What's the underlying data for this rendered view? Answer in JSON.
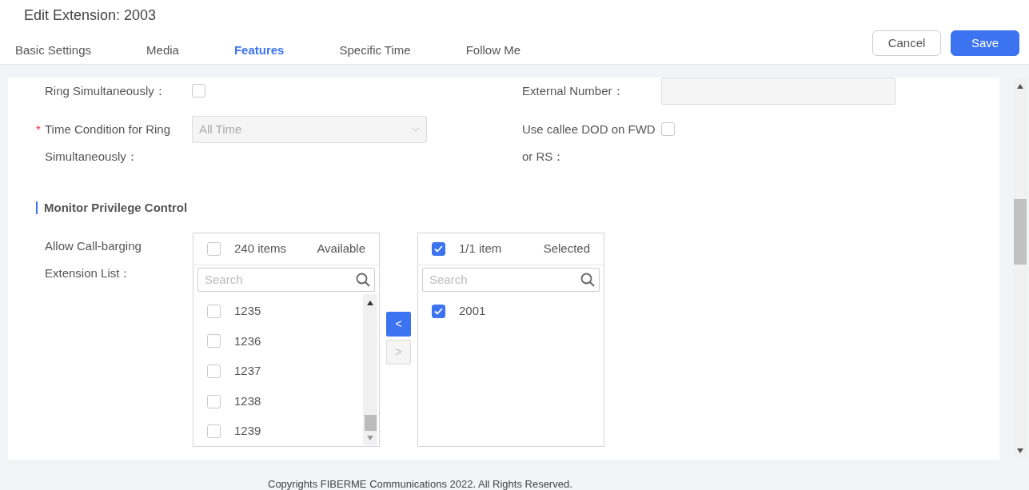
{
  "page_title": "Edit Extension: 2003",
  "tabs": [
    {
      "label": "Basic Settings",
      "selected": false
    },
    {
      "label": "Media",
      "selected": false
    },
    {
      "label": "Features",
      "selected": true
    },
    {
      "label": "Specific Time",
      "selected": false
    },
    {
      "label": "Follow Me",
      "selected": false
    }
  ],
  "actions": [
    {
      "label": "Cancel",
      "kind": "secondary"
    },
    {
      "label": "Save",
      "kind": "primary"
    }
  ],
  "fields": [
    {
      "label": "Ring Simultaneously：",
      "kind": "checkbox",
      "checked": false
    },
    {
      "label": "External Number：",
      "kind": "text",
      "disabled": true
    },
    {
      "label": "Time Condition for Ring Simultaneously：",
      "required_mark": "*",
      "kind": "select",
      "value": "All Time",
      "disabled": true
    },
    {
      "label": "Use callee DOD on FWD or RS：",
      "kind": "checkbox",
      "checked": false
    }
  ],
  "section_title": "Monitor Privilege Control",
  "transfer": {
    "label": "Allow Call-barging Extension List：",
    "source": {
      "all_checked": false,
      "count": "240 items",
      "title": "Available",
      "placeholder": "Search",
      "scrollable": true,
      "items": [
        {
          "label": "1235",
          "checked": false
        },
        {
          "label": "1236",
          "checked": false
        },
        {
          "label": "1237",
          "checked": false
        },
        {
          "label": "1238",
          "checked": false
        },
        {
          "label": "1239",
          "checked": false
        }
      ]
    },
    "buttons": [
      {
        "label": "<",
        "disabled": false
      },
      {
        "label": ">",
        "disabled": true
      }
    ],
    "target": {
      "all_checked": true,
      "count": "1/1 item",
      "title": "Selected",
      "placeholder": "Search",
      "items": [
        {
          "label": "2001",
          "checked": true
        }
      ]
    }
  },
  "footer": "Copyrights FIBERME Communications 2022. All Rights Reserved."
}
